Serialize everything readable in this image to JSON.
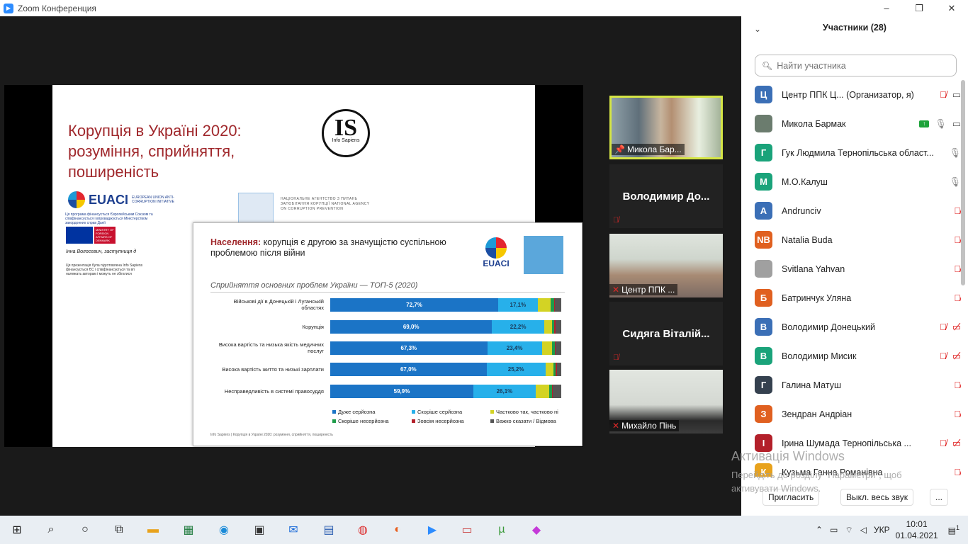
{
  "window": {
    "title": "Zoom Конференция",
    "controls": [
      "–",
      "❐",
      "✕"
    ]
  },
  "slide1": {
    "title": "Корупція в Україні 2020: розуміння, сприйняття, поширеність",
    "is_logo": "IS",
    "is_logo_sub": "Info Sapiens",
    "euaci": "EUACI",
    "euaci_sub": "EUROPEAN UNION ANTI-CORRUPTION INITIATIVE",
    "euaci_small": "Ця програма фінансується Європейським Союзом та співфінансується і впроваджується Міністерством закордонних справ Данії",
    "ministry": "MINISTRY OF FOREIGN AFFAIRS OF DENMARK",
    "presenter": "Інна Волосевич, заступниця д",
    "note": "Ця презентація була підготовлена Info Sapiens фінансується ЄС і співфінансується та вп належать авторам і можуть не збігатися",
    "nacp": "НАЦІОНАЛЬНЕ АГЕНТСТВО З ПИТАНЬ ЗАПОБІГАННЯ КОРУПЦІЇ NATIONAL AGENCY ON CORRUPTION PREVENTION"
  },
  "slide2": {
    "title_bold": "Населення:",
    "title_rest": " корупція є другою за значущістю суспільною проблемою після війни",
    "logo": "EUACI",
    "subtitle": "Сприйняття основних проблем України — ТОП-5 (2020)",
    "footer": "Info Sapiens | Корупція в Україні 2020: розуміння, сприйняття, поширеність"
  },
  "chart_data": {
    "type": "bar",
    "stacked": true,
    "orientation": "horizontal",
    "title": "Сприйняття основних проблем України — ТОП-5 (2020)",
    "categories": [
      "Військові дії в Донецькій і Луганській областях",
      "Корупція",
      "Висока вартість та низька якість медичних послуг",
      "Висока вартість життя та низькі зарплати",
      "Несправедливість в системі правосуддя"
    ],
    "series": [
      {
        "name": "Дуже серйозна",
        "color": "#1b74c6",
        "values": [
          72.7,
          69.0,
          67.3,
          67.0,
          59.9
        ],
        "labels": [
          "72,7%",
          "69,0%",
          "67,3%",
          "67,0%",
          "59,9%"
        ]
      },
      {
        "name": "Скоріше серйозна",
        "color": "#27b0ea",
        "values": [
          17.1,
          22.2,
          23.4,
          25.2,
          26.1
        ],
        "labels": [
          "17,1%",
          "22,2%",
          "23,4%",
          "25,2%",
          "26,1%"
        ]
      },
      {
        "name": "Частково так, частково ні",
        "color": "#d3d324",
        "values": [
          5.5,
          3.5,
          4.5,
          3.5,
          5.8
        ]
      },
      {
        "name": "Скоріше несерйозна",
        "color": "#1e9c4a",
        "values": [
          1.5,
          0.8,
          1.0,
          1.0,
          1.0
        ]
      },
      {
        "name": "Зовсім несерйозна",
        "color": "#b3202a",
        "values": [
          0.4,
          0.5,
          0.5,
          0.4,
          0.4
        ]
      },
      {
        "name": "Важко сказати / Відмова",
        "color": "#555555",
        "values": [
          2.8,
          2.5,
          2.3,
          1.9,
          3.5
        ]
      }
    ],
    "xlim": [
      0,
      100
    ],
    "legend": "bottom"
  },
  "videos": [
    {
      "name": "Микола Бар...",
      "active": true,
      "muted": false
    },
    {
      "name": "Володимир До...",
      "muted": true
    },
    {
      "name": "Центр ППК ...",
      "muted": true
    },
    {
      "name": "Сидяга Віталій...",
      "muted": true
    },
    {
      "name": "Михайло Пінь",
      "muted": true
    }
  ],
  "panel": {
    "title": "Участники (28)",
    "search_placeholder": "Найти участника",
    "participants": [
      {
        "initial": "Ц",
        "color": "#3b6fb6",
        "name": "Центр ППК Ц... (Организатор, я)",
        "mic": "off",
        "cam": "on"
      },
      {
        "initial": "",
        "color": "#6b7c6e",
        "name": "Микола Бармак",
        "mic": "on",
        "cam": "on",
        "sharing": true
      },
      {
        "initial": "Г",
        "color": "#1aa37a",
        "name": "Гук Людмила Тернопільська област...",
        "mic": "on"
      },
      {
        "initial": "М",
        "color": "#1aa37a",
        "name": "М.О.Калуш",
        "mic": "on"
      },
      {
        "initial": "А",
        "color": "#3b6fb6",
        "name": "Andrunciv",
        "mic": "off"
      },
      {
        "initial": "NB",
        "color": "#e06020",
        "name": "Natalia Buda",
        "mic": "off"
      },
      {
        "initial": "",
        "color": "#a0a0a0",
        "name": "Svitlana Yahvan",
        "mic": "off"
      },
      {
        "initial": "Б",
        "color": "#e06020",
        "name": "Батринчук Уляна",
        "mic": "off"
      },
      {
        "initial": "В",
        "color": "#3b6fb6",
        "name": "Володимир Донецький",
        "mic": "off",
        "cam": "off"
      },
      {
        "initial": "В",
        "color": "#1aa37a",
        "name": "Володимир Мисик",
        "mic": "off",
        "cam": "off"
      },
      {
        "initial": "Г",
        "color": "#35414f",
        "name": "Галина Матуш",
        "mic": "off"
      },
      {
        "initial": "З",
        "color": "#e06020",
        "name": "Зендран Андріан",
        "mic": "off"
      },
      {
        "initial": "І",
        "color": "#b3202a",
        "name": "Ірина Шумада Тернопільська ...",
        "mic": "off",
        "cam": "off"
      },
      {
        "initial": "К",
        "color": "#e8a21c",
        "name": "Кузьма Ганна Романівна",
        "mic": "off"
      }
    ],
    "invite": "Пригласить",
    "mute_all": "Выкл. весь звук",
    "more": "..."
  },
  "activation": {
    "title": "Активація Windows",
    "text": "Перейдіть до розділу \"Параметри\", щоб активувати Windows."
  },
  "taskbar": {
    "lang": "УКР",
    "time": "10:01",
    "date": "01.04.2021",
    "notif_count": "1"
  }
}
